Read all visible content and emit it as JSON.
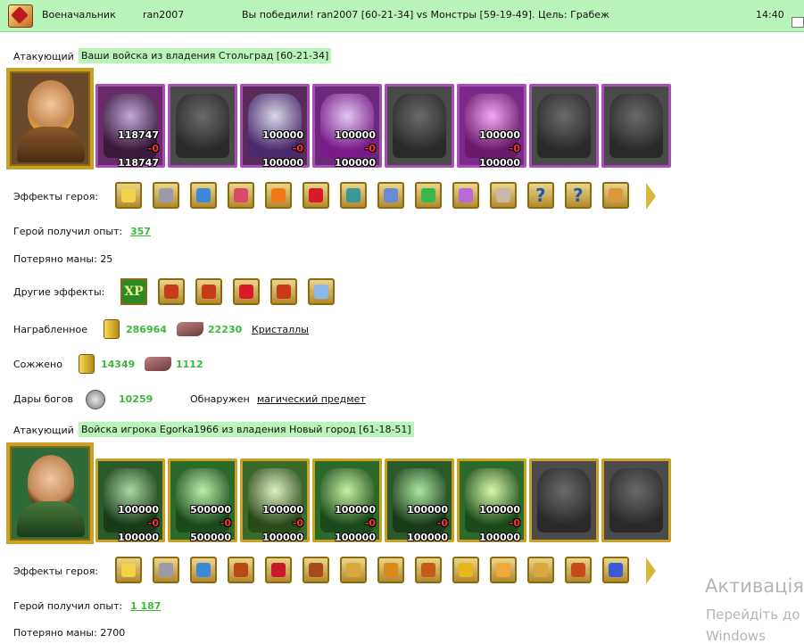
{
  "topbar": {
    "title": "Военачальник",
    "player": "ran2007",
    "result": "Вы победили! ran2007 [60-21-34] vs Монстры [59-19-49]. Цель: Грабеж",
    "time": "14:40"
  },
  "attacker1": {
    "label": "Атакующий",
    "army": "Ваши войска из владения Стольград [60-21-34]",
    "units": [
      {
        "top": "118747",
        "loss": "-0",
        "bottom": "118747"
      },
      {
        "top": "",
        "loss": "",
        "bottom": ""
      },
      {
        "top": "100000",
        "loss": "-0",
        "bottom": "100000"
      },
      {
        "top": "100000",
        "loss": "-0",
        "bottom": "100000"
      },
      {
        "top": "",
        "loss": "",
        "bottom": ""
      },
      {
        "top": "100000",
        "loss": "-0",
        "bottom": "100000"
      },
      {
        "top": "",
        "loss": "",
        "bottom": ""
      },
      {
        "top": "",
        "loss": "",
        "bottom": ""
      }
    ],
    "effects_label": "Эффекты героя:",
    "exp_label": "Герой получил опыт:",
    "exp_value": "357",
    "mana_label": "Потеряно маны: 25",
    "other_effects_label": "Другие эффекты:",
    "other_effects_xp": "XP",
    "loot_label": "Награбленное",
    "loot_gold": "286964",
    "loot_crystals": "22230",
    "loot_link": "Кристаллы",
    "burned_label": "Сожжено",
    "burned_gold": "14349",
    "burned_crystals": "1112",
    "gifts_label": "Дары богов",
    "gifts_value": "10259",
    "found_label": "Обнаружен",
    "found_link": "магический предмет"
  },
  "attacker2": {
    "label": "Атакующий",
    "army": "Войска игрока Egorka1966 из владения Новый город [61-18-51]",
    "units": [
      {
        "top": "100000",
        "loss": "-0",
        "bottom": "100000"
      },
      {
        "top": "500000",
        "loss": "-0",
        "bottom": "500000"
      },
      {
        "top": "100000",
        "loss": "-0",
        "bottom": "100000"
      },
      {
        "top": "100000",
        "loss": "-0",
        "bottom": "100000"
      },
      {
        "top": "100000",
        "loss": "-0",
        "bottom": "100000"
      },
      {
        "top": "100000",
        "loss": "-0",
        "bottom": "100000"
      },
      {
        "top": "",
        "loss": "",
        "bottom": ""
      },
      {
        "top": "",
        "loss": "",
        "bottom": ""
      }
    ],
    "effects_label": "Эффекты героя:",
    "exp_label": "Герой получил опыт:",
    "exp_value": "1 187",
    "mana_label": "Потеряно маны: 2700"
  },
  "icons": {
    "effects1": [
      "crown-icon",
      "helmet-icon",
      "gauntlet-icon",
      "chest-icon",
      "fire-icon",
      "heart-icon",
      "shield-icon",
      "claw-icon",
      "compass-icon",
      "wings-icon",
      "ring-icon",
      "question-icon",
      "question-icon",
      "bird-icon"
    ],
    "other1": [
      "sword-fist-icon",
      "sword-fist-icon",
      "heart-shield-icon",
      "sword-fist-icon",
      "sword-icon"
    ],
    "effects2": [
      "crown-icon",
      "helmet-icon",
      "gauntlet-icon",
      "rune-icon",
      "heart-rune-icon",
      "cross-rune-icon",
      "amulet-icon",
      "bolt-rune-icon",
      "scroll-icon",
      "pouch-icon",
      "dagger-icon",
      "star-rune-icon",
      "book-icon",
      "column-icon"
    ]
  },
  "watermark": {
    "line1": "Активація",
    "line2": "Перейдіть до",
    "line3": "Windows"
  },
  "colors": {
    "header_bg": "#b9f5b9",
    "value_green": "#3db83d",
    "slot_purple": "#a84fb5",
    "slot_gold": "#c9a225"
  }
}
